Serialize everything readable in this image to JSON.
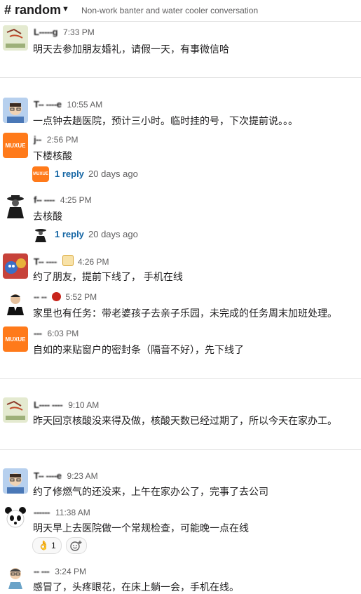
{
  "channel": {
    "name": "# random",
    "topic": "Non-work banter and water cooler conversation"
  },
  "messages": [
    {
      "user": "L-----g",
      "time": "7:33 PM",
      "text": "明天去参加朋友婚礼，请假一天，有事微信哈"
    },
    {
      "user": "T-- ----e",
      "time": "10:55 AM",
      "text": "一点钟去趟医院，预计三小时。临时挂的号，下次提前说。。。"
    },
    {
      "user": "j--",
      "time": "2:56 PM",
      "text": "下楼核酸",
      "thread": {
        "replies": "1 reply",
        "ago": "20 days ago"
      }
    },
    {
      "user": "f-- ----",
      "time": "4:25 PM",
      "text": "去核酸",
      "thread": {
        "replies": "1 reply",
        "ago": "20 days ago"
      }
    },
    {
      "user": "T-- ----",
      "time": "4:26 PM",
      "text": "约了朋友，提前下线了， 手机在线"
    },
    {
      "user": "-- --",
      "time": "5:52 PM",
      "text": "家里也有任务：带老婆孩子去亲子乐园，未完成的任务周末加班处理。"
    },
    {
      "user": "---",
      "time": "6:03 PM",
      "text": "自如的来贴窗户的密封条（隔音不好），先下线了"
    },
    {
      "user": "L---- ----",
      "time": "9:10 AM",
      "text": "昨天回京核酸没来得及做，核酸天数已经过期了，所以今天在家办工。"
    },
    {
      "user": "T-- ----e",
      "time": "9:23 AM",
      "text": "约了修燃气的还没来，上午在家办公了，完事了去公司"
    },
    {
      "user": "------",
      "time": "11:38 AM",
      "text": "明天早上去医院做一个常规检查，可能晚一点在线",
      "reaction": {
        "emoji": "👌",
        "count": "1"
      }
    },
    {
      "user": "-- ---",
      "time": "3:24 PM",
      "text": "感冒了，头疼眼花，在床上躺一会，手机在线。"
    }
  ],
  "avatar_label": "MUXUE"
}
